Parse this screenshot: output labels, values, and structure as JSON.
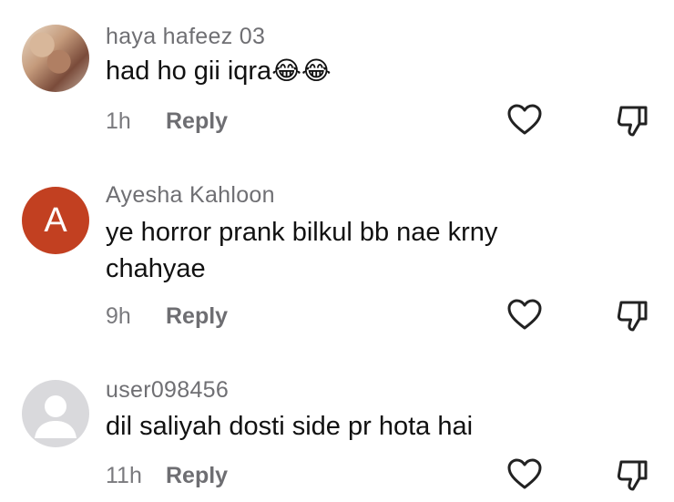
{
  "comments": [
    {
      "username": "haya hafeez 03",
      "text": "had ho gii iqra",
      "emoji": "😂😂",
      "time": "1h",
      "reply_label": "Reply",
      "avatar_type": "photo"
    },
    {
      "username": "Ayesha Kahloon",
      "text": "ye horror prank bilkul bb nae krny chahyae",
      "time": "9h",
      "reply_label": "Reply",
      "avatar_type": "letter",
      "avatar_letter": "A",
      "avatar_color": "#c24021"
    },
    {
      "username": "user098456",
      "text": "dil saliyah dosti side pr hota hai",
      "time": "11h",
      "reply_label": "Reply",
      "avatar_type": "default"
    }
  ],
  "icons": {
    "like": "heart-outline-icon",
    "dislike": "thumbs-down-outline-icon"
  }
}
